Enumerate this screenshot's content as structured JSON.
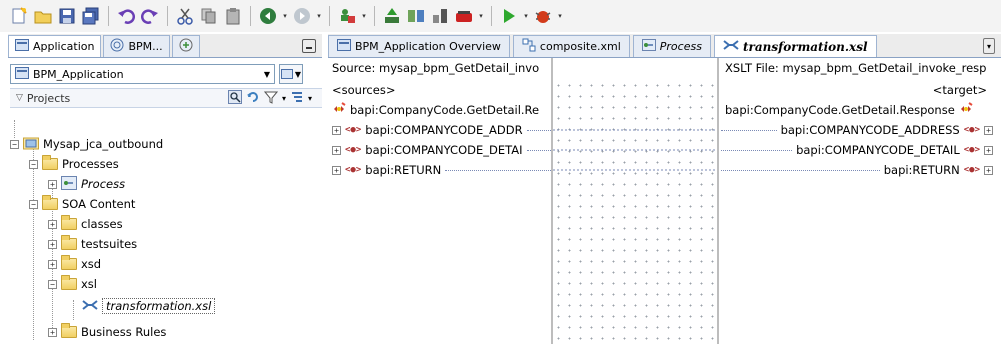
{
  "toolbar": {
    "buttons": [
      "new-icon",
      "open-icon",
      "save-icon",
      "save-all-icon",
      "undo-icon",
      "redo-icon",
      "cut-icon",
      "copy-icon",
      "paste-icon",
      "back-icon",
      "forward-icon",
      "connection-icon",
      "deploy-icon",
      "compare-icon",
      "network-icon",
      "run-icon",
      "debug-icon"
    ]
  },
  "left": {
    "tabs": [
      "Application",
      "BPM...",
      ""
    ],
    "application_selector": "BPM_Application",
    "projects_label": "Projects",
    "tree": [
      {
        "label": "Mysap_jca_outbound"
      },
      {
        "label": "Processes"
      },
      {
        "label": "Process"
      },
      {
        "label": "SOA Content"
      },
      {
        "label": "classes"
      },
      {
        "label": "testsuites"
      },
      {
        "label": "xsd"
      },
      {
        "label": "xsl"
      },
      {
        "label": "transformation.xsl"
      },
      {
        "label": "Business Rules"
      }
    ]
  },
  "editor": {
    "tabs": [
      "BPM_Application Overview",
      "composite.xml",
      "Process",
      "transformation.xsl"
    ],
    "source_header": "Source: mysap_bpm_GetDetail_invo",
    "target_header": "XSLT File: mysap_bpm_GetDetail_invoke_resp",
    "source_root": "<sources>",
    "target_root": "<target>",
    "source_items": [
      "bapi:CompanyCode.GetDetail.Re",
      "bapi:COMPANYCODE_ADDR",
      "bapi:COMPANYCODE_DETAI",
      "bapi:RETURN"
    ],
    "target_items": [
      "bapi:CompanyCode.GetDetail.Response",
      "bapi:COMPANYCODE_ADDRESS",
      "bapi:COMPANYCODE_DETAIL",
      "bapi:RETURN"
    ]
  }
}
